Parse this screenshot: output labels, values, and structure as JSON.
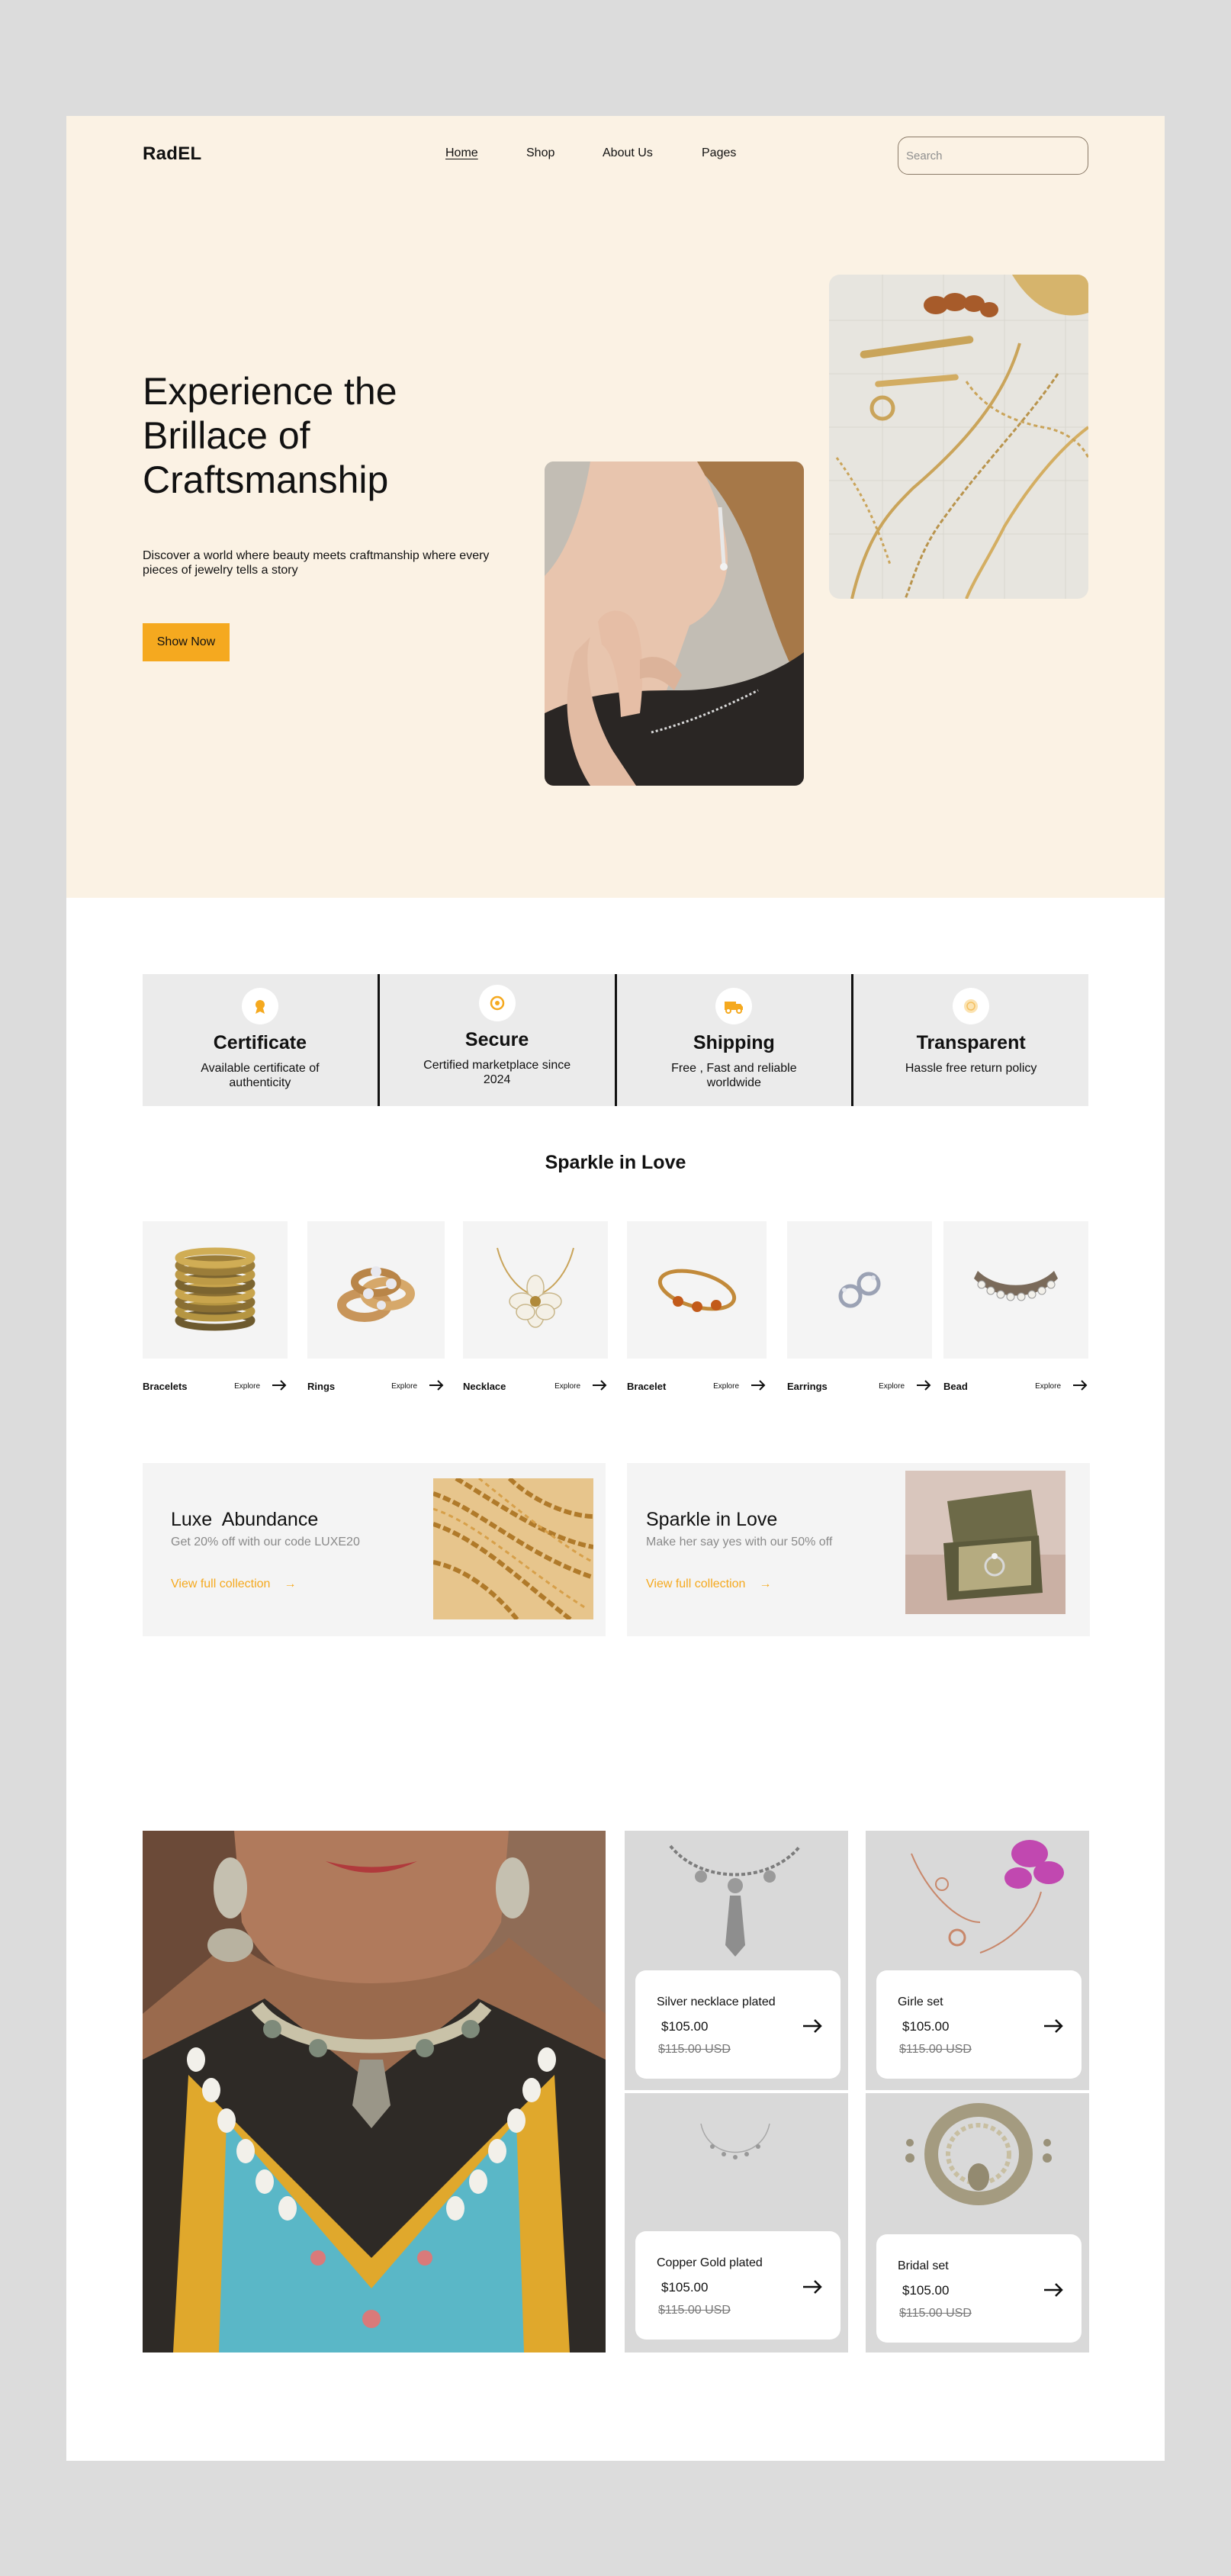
{
  "brand": "RadEL",
  "nav": {
    "items": [
      "Home",
      "Shop",
      "About Us",
      "Pages"
    ],
    "active": "Home"
  },
  "search": {
    "placeholder": "Search",
    "value": ""
  },
  "hero": {
    "title": "Experience the Brillace of Craftsmanship",
    "description": "Discover a world where beauty meets craftmanship where every pieces of jewelry tells a story",
    "button": "Show Now"
  },
  "features": [
    {
      "title": "Certificate",
      "desc": "Available certificate of authenticity",
      "icon": "certificate-icon"
    },
    {
      "title": "Secure",
      "desc": "Certified marketplace since 2024",
      "icon": "secure-icon"
    },
    {
      "title": "Shipping",
      "desc": "Free , Fast and reliable worldwide",
      "icon": "truck-icon"
    },
    {
      "title": "Transparent",
      "desc": "Hassle free return policy",
      "icon": "transparent-icon"
    }
  ],
  "sparkle_title": "Sparkle in Love",
  "explore_label": "Explore",
  "categories": [
    {
      "name": "Bracelets"
    },
    {
      "name": "Rings"
    },
    {
      "name": "Necklace"
    },
    {
      "name": "Bracelet"
    },
    {
      "name": "Earrings"
    },
    {
      "name": "Bead"
    }
  ],
  "promos": [
    {
      "title": "Luxe  Abundance",
      "subtitle": "Get 20% off with our code LUXE20",
      "link": "View full collection"
    },
    {
      "title": "Sparkle in Love",
      "subtitle": "Make her say yes with our 50% off",
      "link": "View full collection"
    }
  ],
  "products": [
    {
      "name": "Silver necklace plated",
      "price": "$105.00",
      "old_price": "$115.00 USD"
    },
    {
      "name": "Girle set",
      "price": "$105.00",
      "old_price": "$115.00 USD"
    },
    {
      "name": "Copper Gold plated",
      "price": "$105.00",
      "old_price": "$115.00 USD"
    },
    {
      "name": "Bridal set",
      "price": "$105.00",
      "old_price": "$115.00 USD"
    }
  ],
  "colors": {
    "accent": "#f5a91f",
    "hero_bg": "#fbf2e4",
    "card_bg": "#f4f4f4",
    "feature_bg": "#ebebeb",
    "product_bg": "#d9d9d9"
  }
}
